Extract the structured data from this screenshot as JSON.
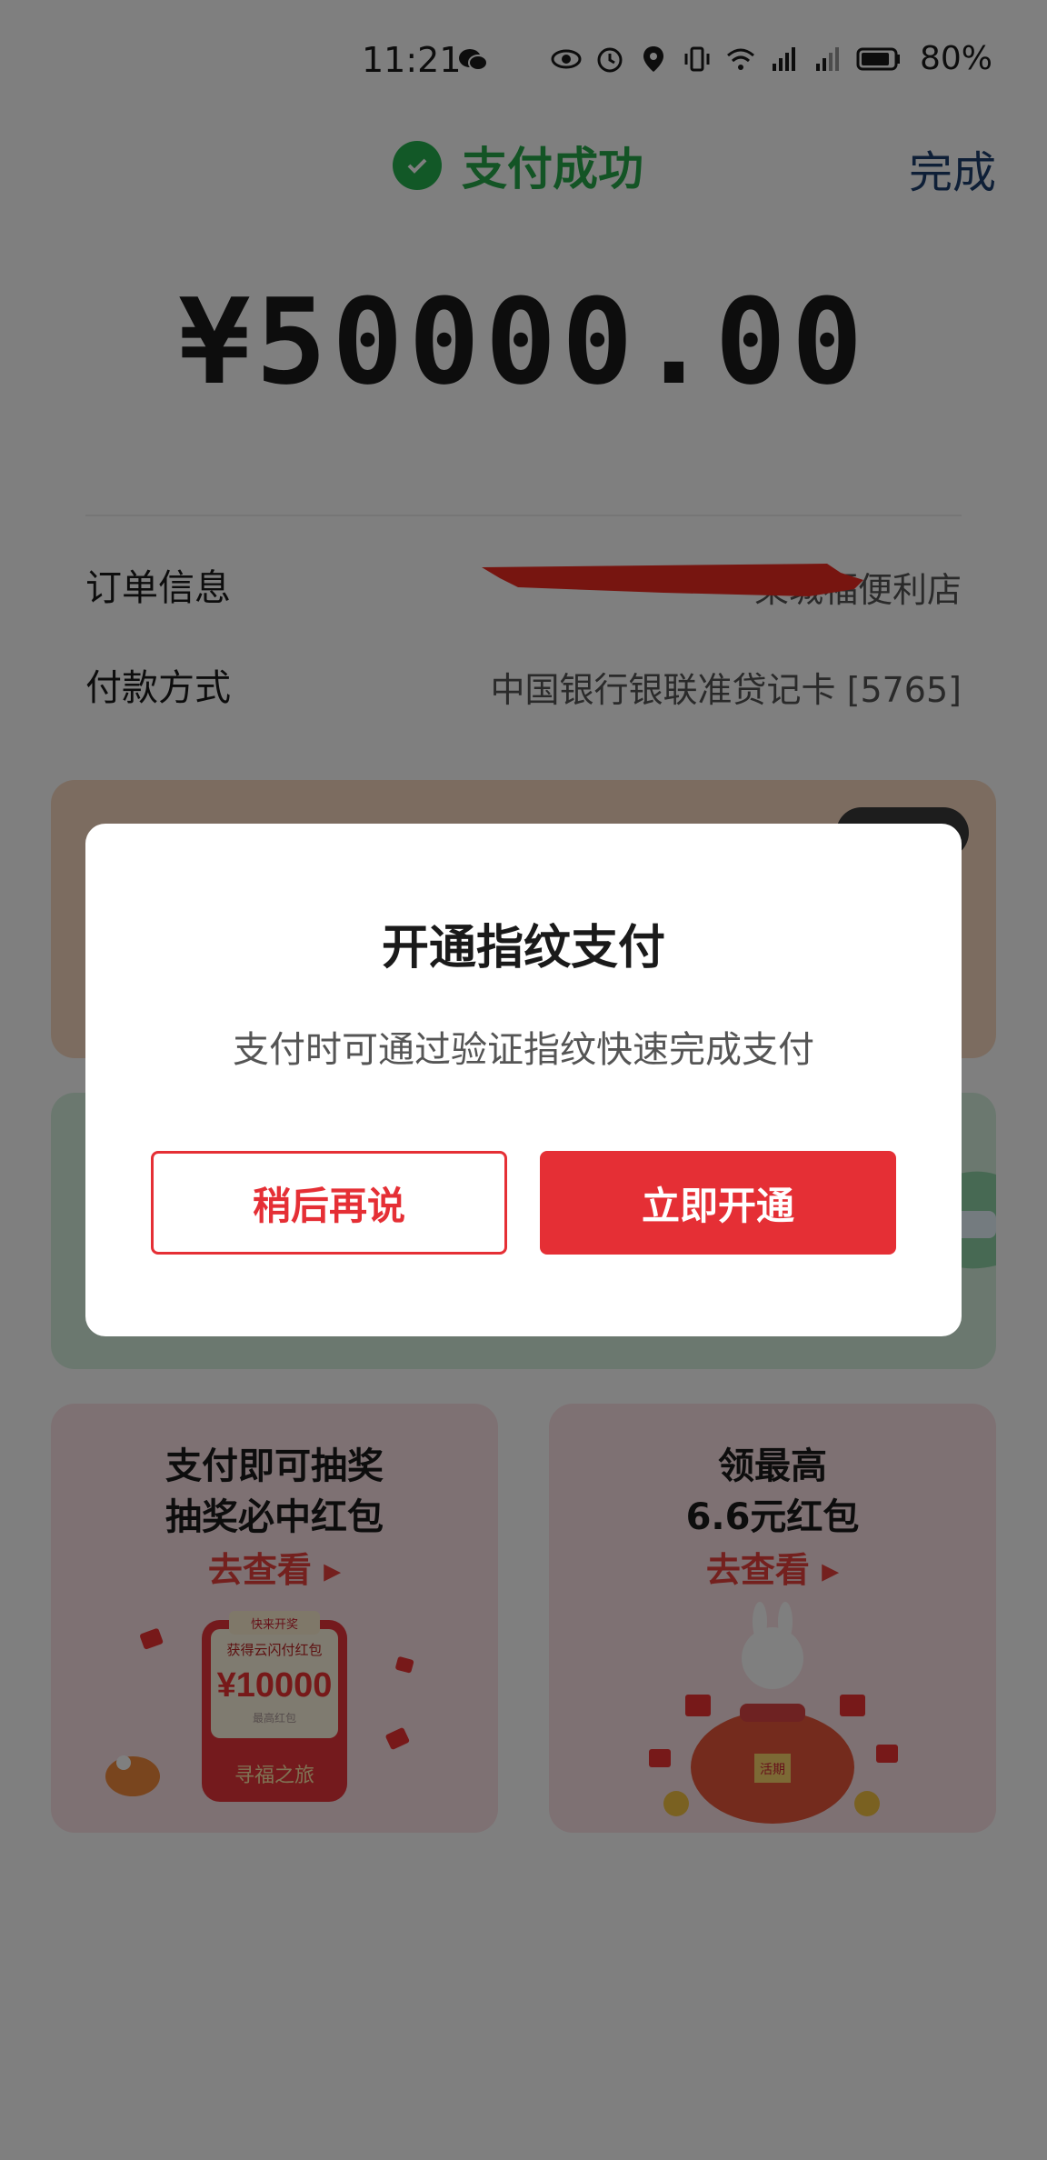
{
  "status_bar": {
    "time": "11:21",
    "battery": "80%"
  },
  "header": {
    "success_text": "支付成功",
    "done_label": "完成"
  },
  "amount": "¥50000.00",
  "order_info": {
    "label": "订单信息",
    "value_visible": "某城福便利店"
  },
  "payment_method": {
    "label": "付款方式",
    "value": "中国银行银联准贷记卡 [5765]"
  },
  "promos": [
    {
      "line1": "支付即可抽奖",
      "line2": "抽奖必中红包",
      "cta": "去查看",
      "art": {
        "top_label": "快来开奖",
        "card_title": "获得云闪付红包",
        "card_amount": "¥10000",
        "card_caption": "最高红包",
        "footer_text": "寻福之旅"
      }
    },
    {
      "line1": "领最高",
      "line2": "6.6元红包",
      "cta": "去查看",
      "art": {
        "bag_label": "活期"
      }
    }
  ],
  "dialog": {
    "title": "开通指纹支付",
    "message": "支付时可通过验证指纹快速完成支付",
    "later_label": "稍后再说",
    "open_label": "立即开通"
  },
  "colors": {
    "success_green": "#27a84a",
    "done_blue": "#1c3f6e",
    "accent_red": "#e52f35",
    "overlay": "rgba(0,0,0,0.5)"
  },
  "icons": [
    "wechat-icon",
    "eye-icon",
    "alarm-icon",
    "location-icon",
    "vibrate-icon",
    "wifi-icon",
    "signal-icon",
    "battery-icon",
    "check-circle-icon"
  ]
}
